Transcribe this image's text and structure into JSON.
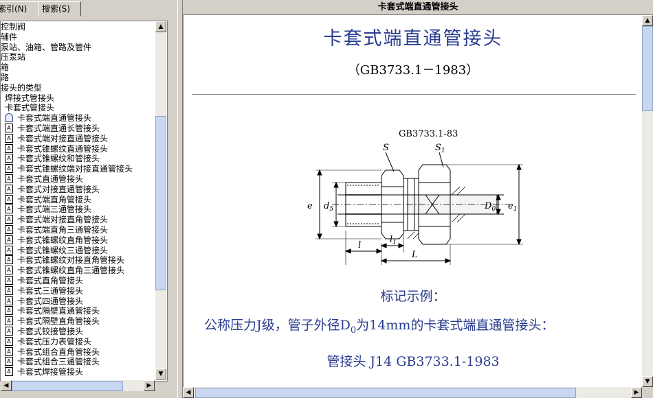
{
  "tabs": [
    {
      "label": "索引(N)"
    },
    {
      "label": "搜索(S)"
    }
  ],
  "tree": {
    "items": [
      {
        "label": "控制阀",
        "indent": 0,
        "icon": "none"
      },
      {
        "label": "辅件",
        "indent": 0,
        "icon": "none"
      },
      {
        "label": "泵站、油箱、管路及管件",
        "indent": 0,
        "icon": "none"
      },
      {
        "label": "压泵站",
        "indent": 0,
        "icon": "none"
      },
      {
        "label": "箱",
        "indent": 0,
        "icon": "none"
      },
      {
        "label": "路",
        "indent": 0,
        "icon": "none"
      },
      {
        "label": "接头的类型",
        "indent": 0,
        "icon": "none"
      },
      {
        "label": "焊接式管接头",
        "indent": 1,
        "icon": "none"
      },
      {
        "label": "卡套式管接头",
        "indent": 1,
        "icon": "none"
      },
      {
        "label": "卡套式端直通管接头",
        "indent": 1,
        "icon": "open-book"
      },
      {
        "label": "卡套式端直通长管接头",
        "indent": 1,
        "icon": "page"
      },
      {
        "label": "卡套式端对接直通管接头",
        "indent": 1,
        "icon": "page"
      },
      {
        "label": "卡套式锥螺纹直通管接头",
        "indent": 1,
        "icon": "page"
      },
      {
        "label": "卡套式锥螺纹和管接头",
        "indent": 1,
        "icon": "page"
      },
      {
        "label": "卡套式锥螺纹端对接直通管接头",
        "indent": 1,
        "icon": "page"
      },
      {
        "label": "卡套式直通管接头",
        "indent": 1,
        "icon": "page"
      },
      {
        "label": "卡套式对接直通管接头",
        "indent": 1,
        "icon": "page"
      },
      {
        "label": "卡套式端直角管接头",
        "indent": 1,
        "icon": "page"
      },
      {
        "label": "卡套式端三通管接头",
        "indent": 1,
        "icon": "page"
      },
      {
        "label": "卡套式端对接直角管接头",
        "indent": 1,
        "icon": "page"
      },
      {
        "label": "卡套式端直角三通管接头",
        "indent": 1,
        "icon": "page"
      },
      {
        "label": "卡套式锥螺纹直角管接头",
        "indent": 1,
        "icon": "page"
      },
      {
        "label": "卡套式锥螺纹三通管接头",
        "indent": 1,
        "icon": "page"
      },
      {
        "label": "卡套式锥螺纹对接直角管接头",
        "indent": 1,
        "icon": "page"
      },
      {
        "label": "卡套式锥螺纹直角三通管接头",
        "indent": 1,
        "icon": "page"
      },
      {
        "label": "卡套式直角管接头",
        "indent": 1,
        "icon": "page"
      },
      {
        "label": "卡套式三通管接头",
        "indent": 1,
        "icon": "page"
      },
      {
        "label": "卡套式四通管接头",
        "indent": 1,
        "icon": "page"
      },
      {
        "label": "卡套式隔壁直通管接头",
        "indent": 1,
        "icon": "page"
      },
      {
        "label": "卡套式隔壁直角管接头",
        "indent": 1,
        "icon": "page"
      },
      {
        "label": "卡套式铰接管接头",
        "indent": 1,
        "icon": "page"
      },
      {
        "label": "卡套式压力表管接头",
        "indent": 1,
        "icon": "page"
      },
      {
        "label": "卡套式组合直角管接头",
        "indent": 1,
        "icon": "page"
      },
      {
        "label": "卡套式组合三通管接头",
        "indent": 1,
        "icon": "page"
      },
      {
        "label": "卡套式焊接管接头",
        "indent": 1,
        "icon": "page"
      }
    ]
  },
  "window_title": "卡套式端直通管接头",
  "doc": {
    "title": "卡套式端直通管接头",
    "standard": "（GB3733.1－1983）",
    "figure": {
      "caption": "GB3733.1-83",
      "labels": {
        "S": "S",
        "S1": "S",
        "S1_sub": "1",
        "e": "e",
        "d5": "d",
        "d5_sub": "5",
        "D0": "D",
        "D0_sub": "0",
        "e1": "e",
        "e1_sub": "1",
        "l": "l",
        "l1": "l",
        "l1_sub": "1",
        "L": "L"
      }
    },
    "example_title": "标记示例：",
    "example_pre": "公称压力J级，管子外径D",
    "example_sub": "0",
    "example_post": "为14mm的卡套式端直通管接头：",
    "designation": "管接头 J14 GB3733.1-1983"
  },
  "icons": {
    "page": "page-icon",
    "open_book": "open-book-icon",
    "scroll_up": "▲",
    "scroll_down": "▼",
    "scroll_left": "◀",
    "scroll_right": "▶"
  }
}
